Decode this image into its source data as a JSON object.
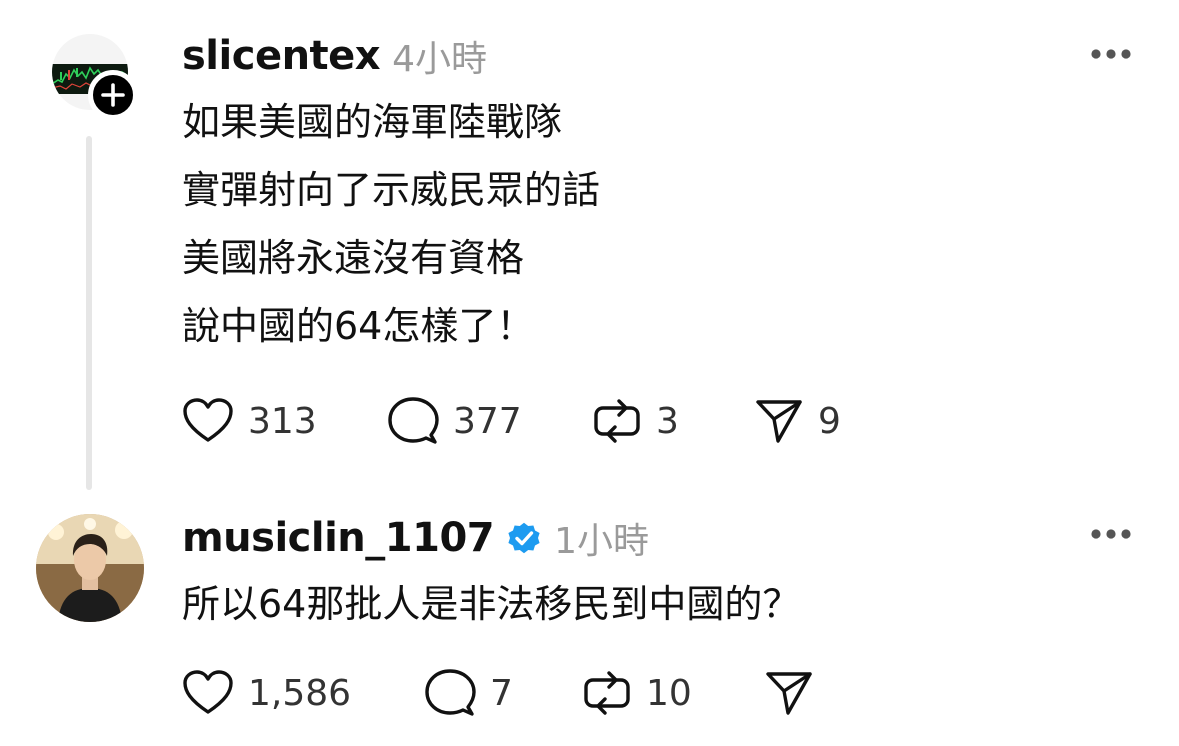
{
  "posts": [
    {
      "username": "slicentex",
      "time": "4小時",
      "verified": false,
      "body_lines": [
        "如果美國的海軍陸戰隊",
        "實彈射向了示威民眾的話",
        "美國將永遠沒有資格",
        "說中國的64怎樣了！"
      ],
      "likes": "313",
      "replies": "377",
      "reposts": "3",
      "shares": "9"
    },
    {
      "username": "musiclin_1107",
      "time": "1小時",
      "verified": true,
      "body_lines": [
        "所以64那批人是非法移民到中國的？"
      ],
      "likes": "1,586",
      "replies": "7",
      "reposts": "10",
      "shares": ""
    }
  ],
  "icons": {
    "like": "heart-icon",
    "reply": "speech-bubble-icon",
    "repost": "repost-icon",
    "share": "send-icon",
    "more": "more-options-icon",
    "verified": "verified-badge-icon",
    "follow": "plus-icon"
  },
  "colors": {
    "text": "#111111",
    "muted": "#9a9a9a",
    "verified": "#1d9bf0",
    "thread_line": "#e6e6e6"
  }
}
